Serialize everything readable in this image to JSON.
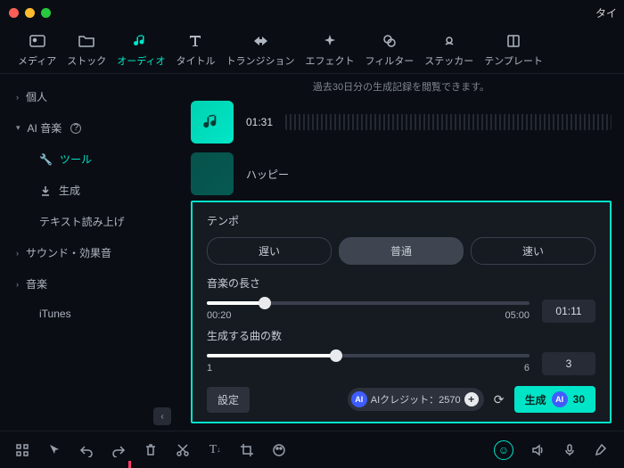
{
  "title_right": "タイ",
  "tabs": [
    {
      "label": "メディア"
    },
    {
      "label": "ストック"
    },
    {
      "label": "オーディオ"
    },
    {
      "label": "タイトル"
    },
    {
      "label": "トランジション"
    },
    {
      "label": "エフェクト"
    },
    {
      "label": "フィルター"
    },
    {
      "label": "ステッカー"
    },
    {
      "label": "テンプレート"
    }
  ],
  "sidebar": {
    "personal": "個人",
    "ai_music": "AI 音楽",
    "tool": "ツール",
    "generate": "生成",
    "tts": "テキスト読み上げ",
    "sfx": "サウンド・効果音",
    "music": "音楽",
    "itunes": "iTunes"
  },
  "hint": "過去30日分の生成記録を閲覧できます。",
  "clip1_time": "01:31",
  "clip2_label": "ハッピー",
  "panel": {
    "tempo_label": "テンポ",
    "slow": "遅い",
    "normal": "普通",
    "fast": "速い",
    "length_label": "音楽の長さ",
    "min_time": "00:20",
    "max_time": "05:00",
    "cur_time": "01:11",
    "count_label": "生成する曲の数",
    "count_min": "1",
    "count_max": "6",
    "count_val": "3",
    "settings": "設定",
    "credit": "AIクレジット：2570",
    "gen": "生成",
    "gen_cost": "30"
  }
}
